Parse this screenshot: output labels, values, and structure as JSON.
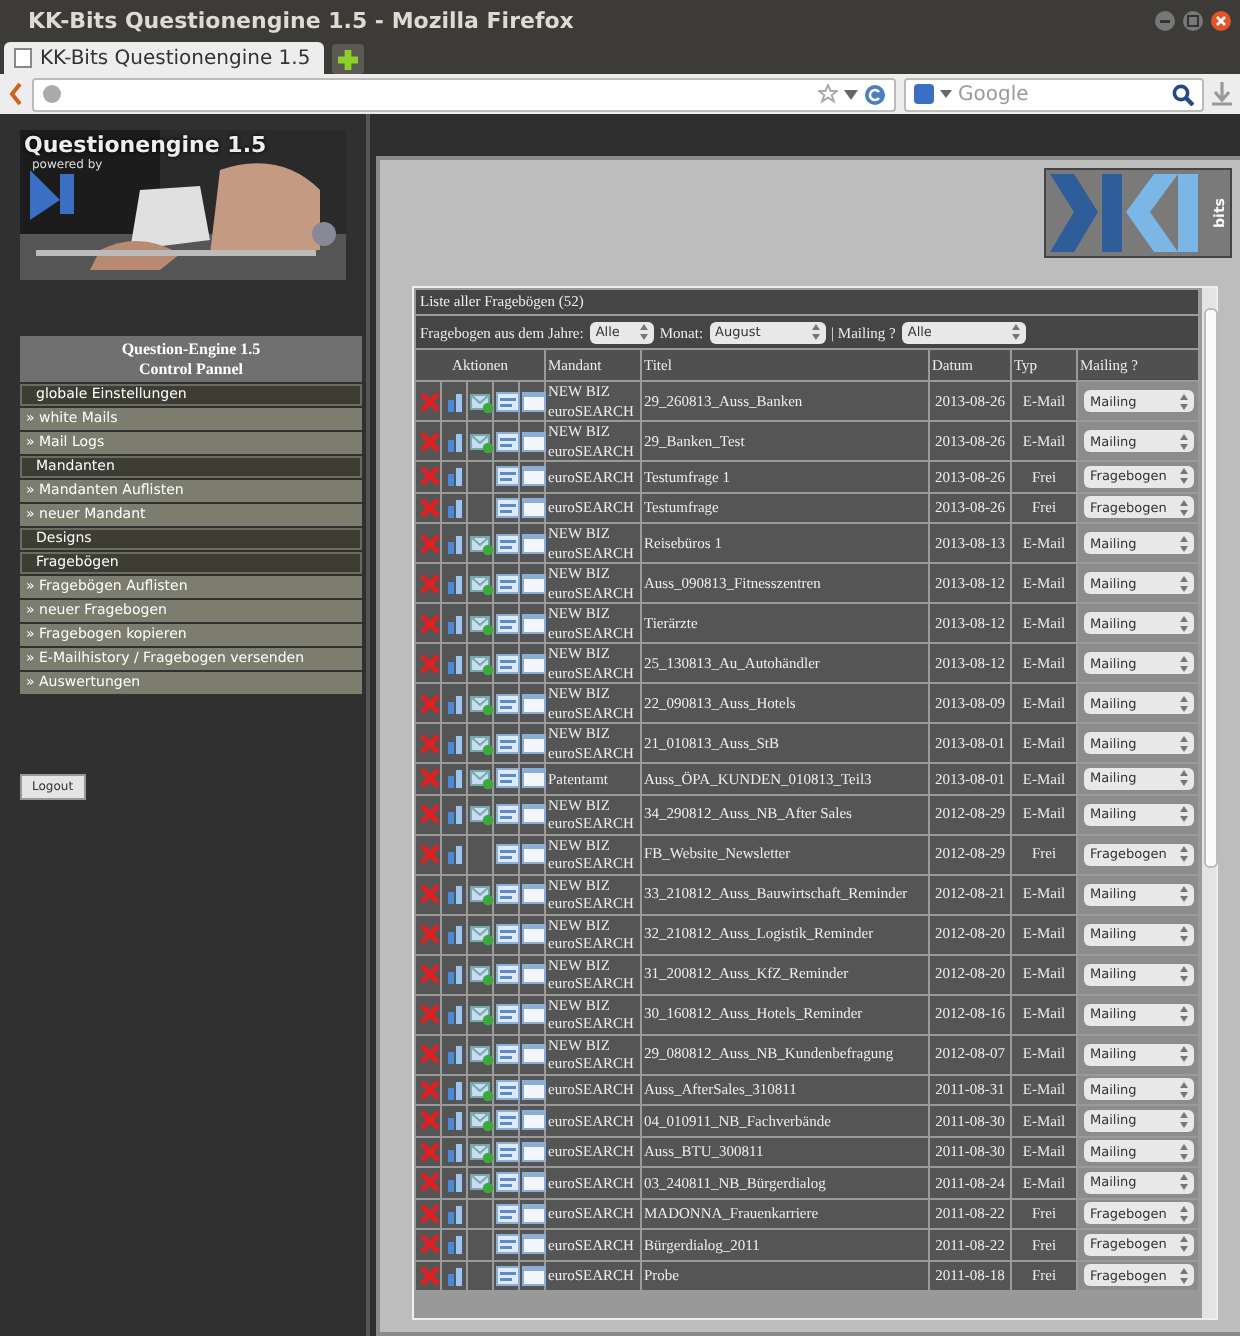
{
  "window": {
    "title": "KK-Bits Questionengine 1.5 - Mozilla Firefox"
  },
  "tab": {
    "label": "KK-Bits Questionengine 1.5",
    "selected": true
  },
  "search": {
    "placeholder": "Google"
  },
  "banner": {
    "title": "Questionengine 1.5",
    "subtitle": "powered by"
  },
  "logo": {
    "text": "bits"
  },
  "sidebar": {
    "title": "Question-Engine 1.5",
    "subtitle": "Control Pannel",
    "items": [
      {
        "kind": "section",
        "label": "globale Einstellungen"
      },
      {
        "kind": "link",
        "label": "» white Mails"
      },
      {
        "kind": "link",
        "label": "» Mail Logs"
      },
      {
        "kind": "section",
        "label": "Mandanten"
      },
      {
        "kind": "link",
        "label": "» Mandanten Auflisten"
      },
      {
        "kind": "link",
        "label": "» neuer Mandant"
      },
      {
        "kind": "section",
        "label": "Designs"
      },
      {
        "kind": "section",
        "label": "Fragebögen"
      },
      {
        "kind": "link",
        "label": "» Fragebögen Auflisten"
      },
      {
        "kind": "link",
        "label": "» neuer Fragebogen"
      },
      {
        "kind": "link",
        "label": "» Fragebogen kopieren"
      },
      {
        "kind": "link",
        "label": "» E-Mailhistory / Fragebogen versenden"
      },
      {
        "kind": "link",
        "label": "» Auswertungen"
      }
    ],
    "logout": "Logout"
  },
  "table": {
    "title": "Liste aller Fragebögen (52)",
    "filters": [
      {
        "label": "Fragebogen aus dem Jahre:",
        "value": "Alle"
      },
      {
        "label": "Monat:",
        "value": "August"
      },
      {
        "label": "| Mailing ?",
        "value": "Alle"
      }
    ],
    "columns": [
      "Aktionen",
      "Mandant",
      "Titel",
      "Datum",
      "Typ",
      "Mailing ?"
    ],
    "rows": [
      {
        "mandant": "NEW BIZ euroSEARCH",
        "title": "29_260813_Auss_Banken",
        "date": "2013-08-26",
        "type": "E-Mail",
        "mailing": "Mailing",
        "send": true
      },
      {
        "mandant": "NEW BIZ euroSEARCH",
        "title": "29_Banken_Test",
        "date": "2013-08-26",
        "type": "E-Mail",
        "mailing": "Mailing",
        "send": true
      },
      {
        "mandant": "euroSEARCH",
        "title": "Testumfrage 1",
        "date": "2013-08-26",
        "type": "Frei",
        "mailing": "Fragebogen",
        "send": false
      },
      {
        "mandant": "euroSEARCH",
        "title": "Testumfrage",
        "date": "2013-08-26",
        "type": "Frei",
        "mailing": "Fragebogen",
        "send": false
      },
      {
        "mandant": "NEW BIZ euroSEARCH",
        "title": "Reisebüros 1",
        "date": "2013-08-13",
        "type": "E-Mail",
        "mailing": "Mailing",
        "send": true
      },
      {
        "mandant": "NEW BIZ euroSEARCH",
        "title": "Auss_090813_Fitnesszentren",
        "date": "2013-08-12",
        "type": "E-Mail",
        "mailing": "Mailing",
        "send": true
      },
      {
        "mandant": "NEW BIZ euroSEARCH",
        "title": "Tierärzte",
        "date": "2013-08-12",
        "type": "E-Mail",
        "mailing": "Mailing",
        "send": true
      },
      {
        "mandant": "NEW BIZ euroSEARCH",
        "title": "25_130813_Au_Autohändler",
        "date": "2013-08-12",
        "type": "E-Mail",
        "mailing": "Mailing",
        "send": true
      },
      {
        "mandant": "NEW BIZ euroSEARCH",
        "title": "22_090813_Auss_Hotels",
        "date": "2013-08-09",
        "type": "E-Mail",
        "mailing": "Mailing",
        "send": true
      },
      {
        "mandant": "NEW BIZ euroSEARCH",
        "title": "21_010813_Auss_StB",
        "date": "2013-08-01",
        "type": "E-Mail",
        "mailing": "Mailing",
        "send": true
      },
      {
        "mandant": "Patentamt",
        "title": "Auss_ÖPA_KUNDEN_010813_Teil3",
        "date": "2013-08-01",
        "type": "E-Mail",
        "mailing": "Mailing",
        "send": true
      },
      {
        "mandant": "NEW BIZ euroSEARCH",
        "title": "34_290812_Auss_NB_After Sales",
        "date": "2012-08-29",
        "type": "E-Mail",
        "mailing": "Mailing",
        "send": true
      },
      {
        "mandant": "NEW BIZ euroSEARCH",
        "title": "FB_Website_Newsletter",
        "date": "2012-08-29",
        "type": "Frei",
        "mailing": "Fragebogen",
        "send": false
      },
      {
        "mandant": "NEW BIZ euroSEARCH",
        "title": "33_210812_Auss_Bauwirtschaft_Reminder",
        "date": "2012-08-21",
        "type": "E-Mail",
        "mailing": "Mailing",
        "send": true
      },
      {
        "mandant": "NEW BIZ euroSEARCH",
        "title": "32_210812_Auss_Logistik_Reminder",
        "date": "2012-08-20",
        "type": "E-Mail",
        "mailing": "Mailing",
        "send": true
      },
      {
        "mandant": "NEW BIZ euroSEARCH",
        "title": "31_200812_Auss_KfZ_Reminder",
        "date": "2012-08-20",
        "type": "E-Mail",
        "mailing": "Mailing",
        "send": true
      },
      {
        "mandant": "NEW BIZ euroSEARCH",
        "title": "30_160812_Auss_Hotels_Reminder",
        "date": "2012-08-16",
        "type": "E-Mail",
        "mailing": "Mailing",
        "send": true
      },
      {
        "mandant": "NEW BIZ euroSEARCH",
        "title": "29_080812_Auss_NB_Kundenbefragung",
        "date": "2012-08-07",
        "type": "E-Mail",
        "mailing": "Mailing",
        "send": true
      },
      {
        "mandant": "euroSEARCH",
        "title": "Auss_AfterSales_310811",
        "date": "2011-08-31",
        "type": "E-Mail",
        "mailing": "Mailing",
        "send": true
      },
      {
        "mandant": "euroSEARCH",
        "title": "04_010911_NB_Fachverbände",
        "date": "2011-08-30",
        "type": "E-Mail",
        "mailing": "Mailing",
        "send": true
      },
      {
        "mandant": "euroSEARCH",
        "title": "Auss_BTU_300811",
        "date": "2011-08-30",
        "type": "E-Mail",
        "mailing": "Mailing",
        "send": true
      },
      {
        "mandant": "euroSEARCH",
        "title": "03_240811_NB_Bürgerdialog",
        "date": "2011-08-24",
        "type": "E-Mail",
        "mailing": "Mailing",
        "send": true
      },
      {
        "mandant": "euroSEARCH",
        "title": "MADONNA_Frauenkarriere",
        "date": "2011-08-22",
        "type": "Frei",
        "mailing": "Fragebogen",
        "send": false
      },
      {
        "mandant": "euroSEARCH",
        "title": "Bürgerdialog_2011",
        "date": "2011-08-22",
        "type": "Frei",
        "mailing": "Fragebogen",
        "send": false
      },
      {
        "mandant": "euroSEARCH",
        "title": "Probe",
        "date": "2011-08-18",
        "type": "Frei",
        "mailing": "Fragebogen",
        "send": false
      }
    ]
  }
}
